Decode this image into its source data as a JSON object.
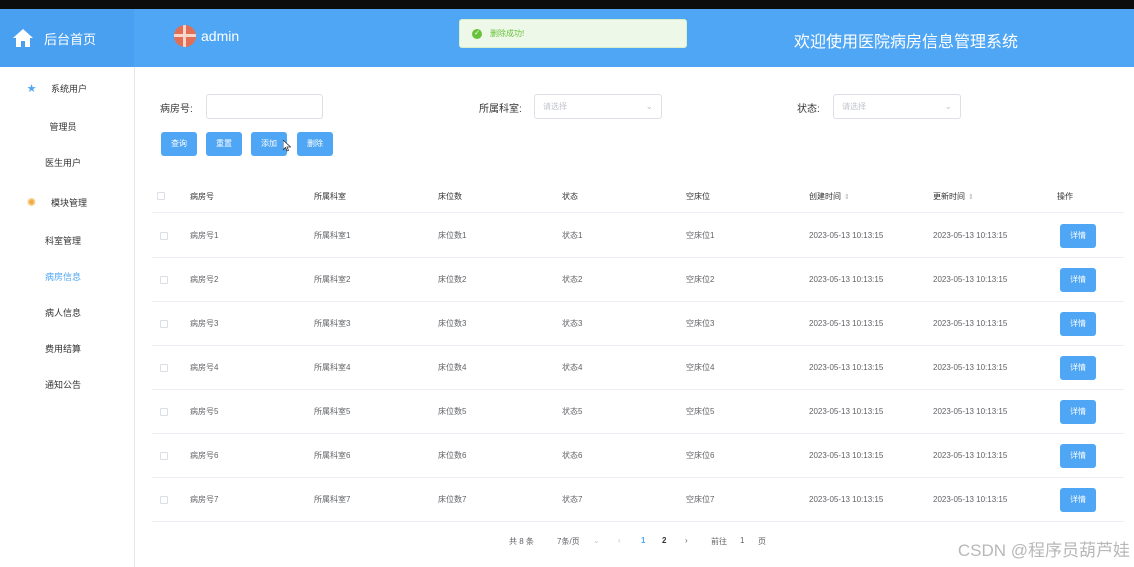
{
  "header": {
    "home_label": "后台首页",
    "username": "admin",
    "site_title": "欢迎使用医院病房信息管理系统"
  },
  "toast": {
    "message": "删除成功!"
  },
  "sidebar": {
    "groups": [
      {
        "label": "系统用户",
        "items": [
          "管理员",
          "医生用户"
        ]
      },
      {
        "label": "模块管理",
        "items": [
          "科室管理",
          "病房信息",
          "病人信息",
          "费用结算",
          "通知公告"
        ]
      }
    ],
    "active_item": "病房信息"
  },
  "filters": {
    "room_no_label": "病房号:",
    "room_no_value": "",
    "dept_label": "所属科室:",
    "dept_placeholder": "请选择",
    "status_label": "状态:",
    "status_placeholder": "请选择"
  },
  "buttons": {
    "query": "查询",
    "reset": "重置",
    "add": "添加",
    "delete": "删除"
  },
  "table": {
    "columns": [
      "病房号",
      "所属科室",
      "床位数",
      "状态",
      "空床位",
      "创建时间",
      "更新时间",
      "操作"
    ],
    "rows": [
      {
        "room": "病房号1",
        "dept": "所属科室1",
        "beds": "床位数1",
        "status": "状态1",
        "empty": "空床位1",
        "created": "2023-05-13 10:13:15",
        "updated": "2023-05-13 10:13:15",
        "action": "详情"
      },
      {
        "room": "病房号2",
        "dept": "所属科室2",
        "beds": "床位数2",
        "status": "状态2",
        "empty": "空床位2",
        "created": "2023-05-13 10:13:15",
        "updated": "2023-05-13 10:13:15",
        "action": "详情"
      },
      {
        "room": "病房号3",
        "dept": "所属科室3",
        "beds": "床位数3",
        "status": "状态3",
        "empty": "空床位3",
        "created": "2023-05-13 10:13:15",
        "updated": "2023-05-13 10:13:15",
        "action": "详情"
      },
      {
        "room": "病房号4",
        "dept": "所属科室4",
        "beds": "床位数4",
        "status": "状态4",
        "empty": "空床位4",
        "created": "2023-05-13 10:13:15",
        "updated": "2023-05-13 10:13:15",
        "action": "详情"
      },
      {
        "room": "病房号5",
        "dept": "所属科室5",
        "beds": "床位数5",
        "status": "状态5",
        "empty": "空床位5",
        "created": "2023-05-13 10:13:15",
        "updated": "2023-05-13 10:13:15",
        "action": "详情"
      },
      {
        "room": "病房号6",
        "dept": "所属科室6",
        "beds": "床位数6",
        "status": "状态6",
        "empty": "空床位6",
        "created": "2023-05-13 10:13:15",
        "updated": "2023-05-13 10:13:15",
        "action": "详情"
      },
      {
        "room": "病房号7",
        "dept": "所属科室7",
        "beds": "床位数7",
        "status": "状态7",
        "empty": "空床位7",
        "created": "2023-05-13 10:13:15",
        "updated": "2023-05-13 10:13:15",
        "action": "详情"
      }
    ]
  },
  "pagination": {
    "total": "共 8 条",
    "page_size": "7条/页",
    "pages": [
      "1",
      "2"
    ],
    "current_page": "1",
    "goto_label": "前往",
    "goto_value": "1",
    "page_suffix": "页"
  },
  "watermark": "CSDN @程序员葫芦娃",
  "colors": {
    "primary": "#4fa6f4",
    "success": "#67c23a",
    "header_bg": "#4fa6f4"
  },
  "icons": {
    "home": "home-icon",
    "users_group": "star-icon",
    "modules_group": "gear-icon",
    "toast": "check-circle-icon",
    "cursor": "mouse-cursor-icon"
  }
}
